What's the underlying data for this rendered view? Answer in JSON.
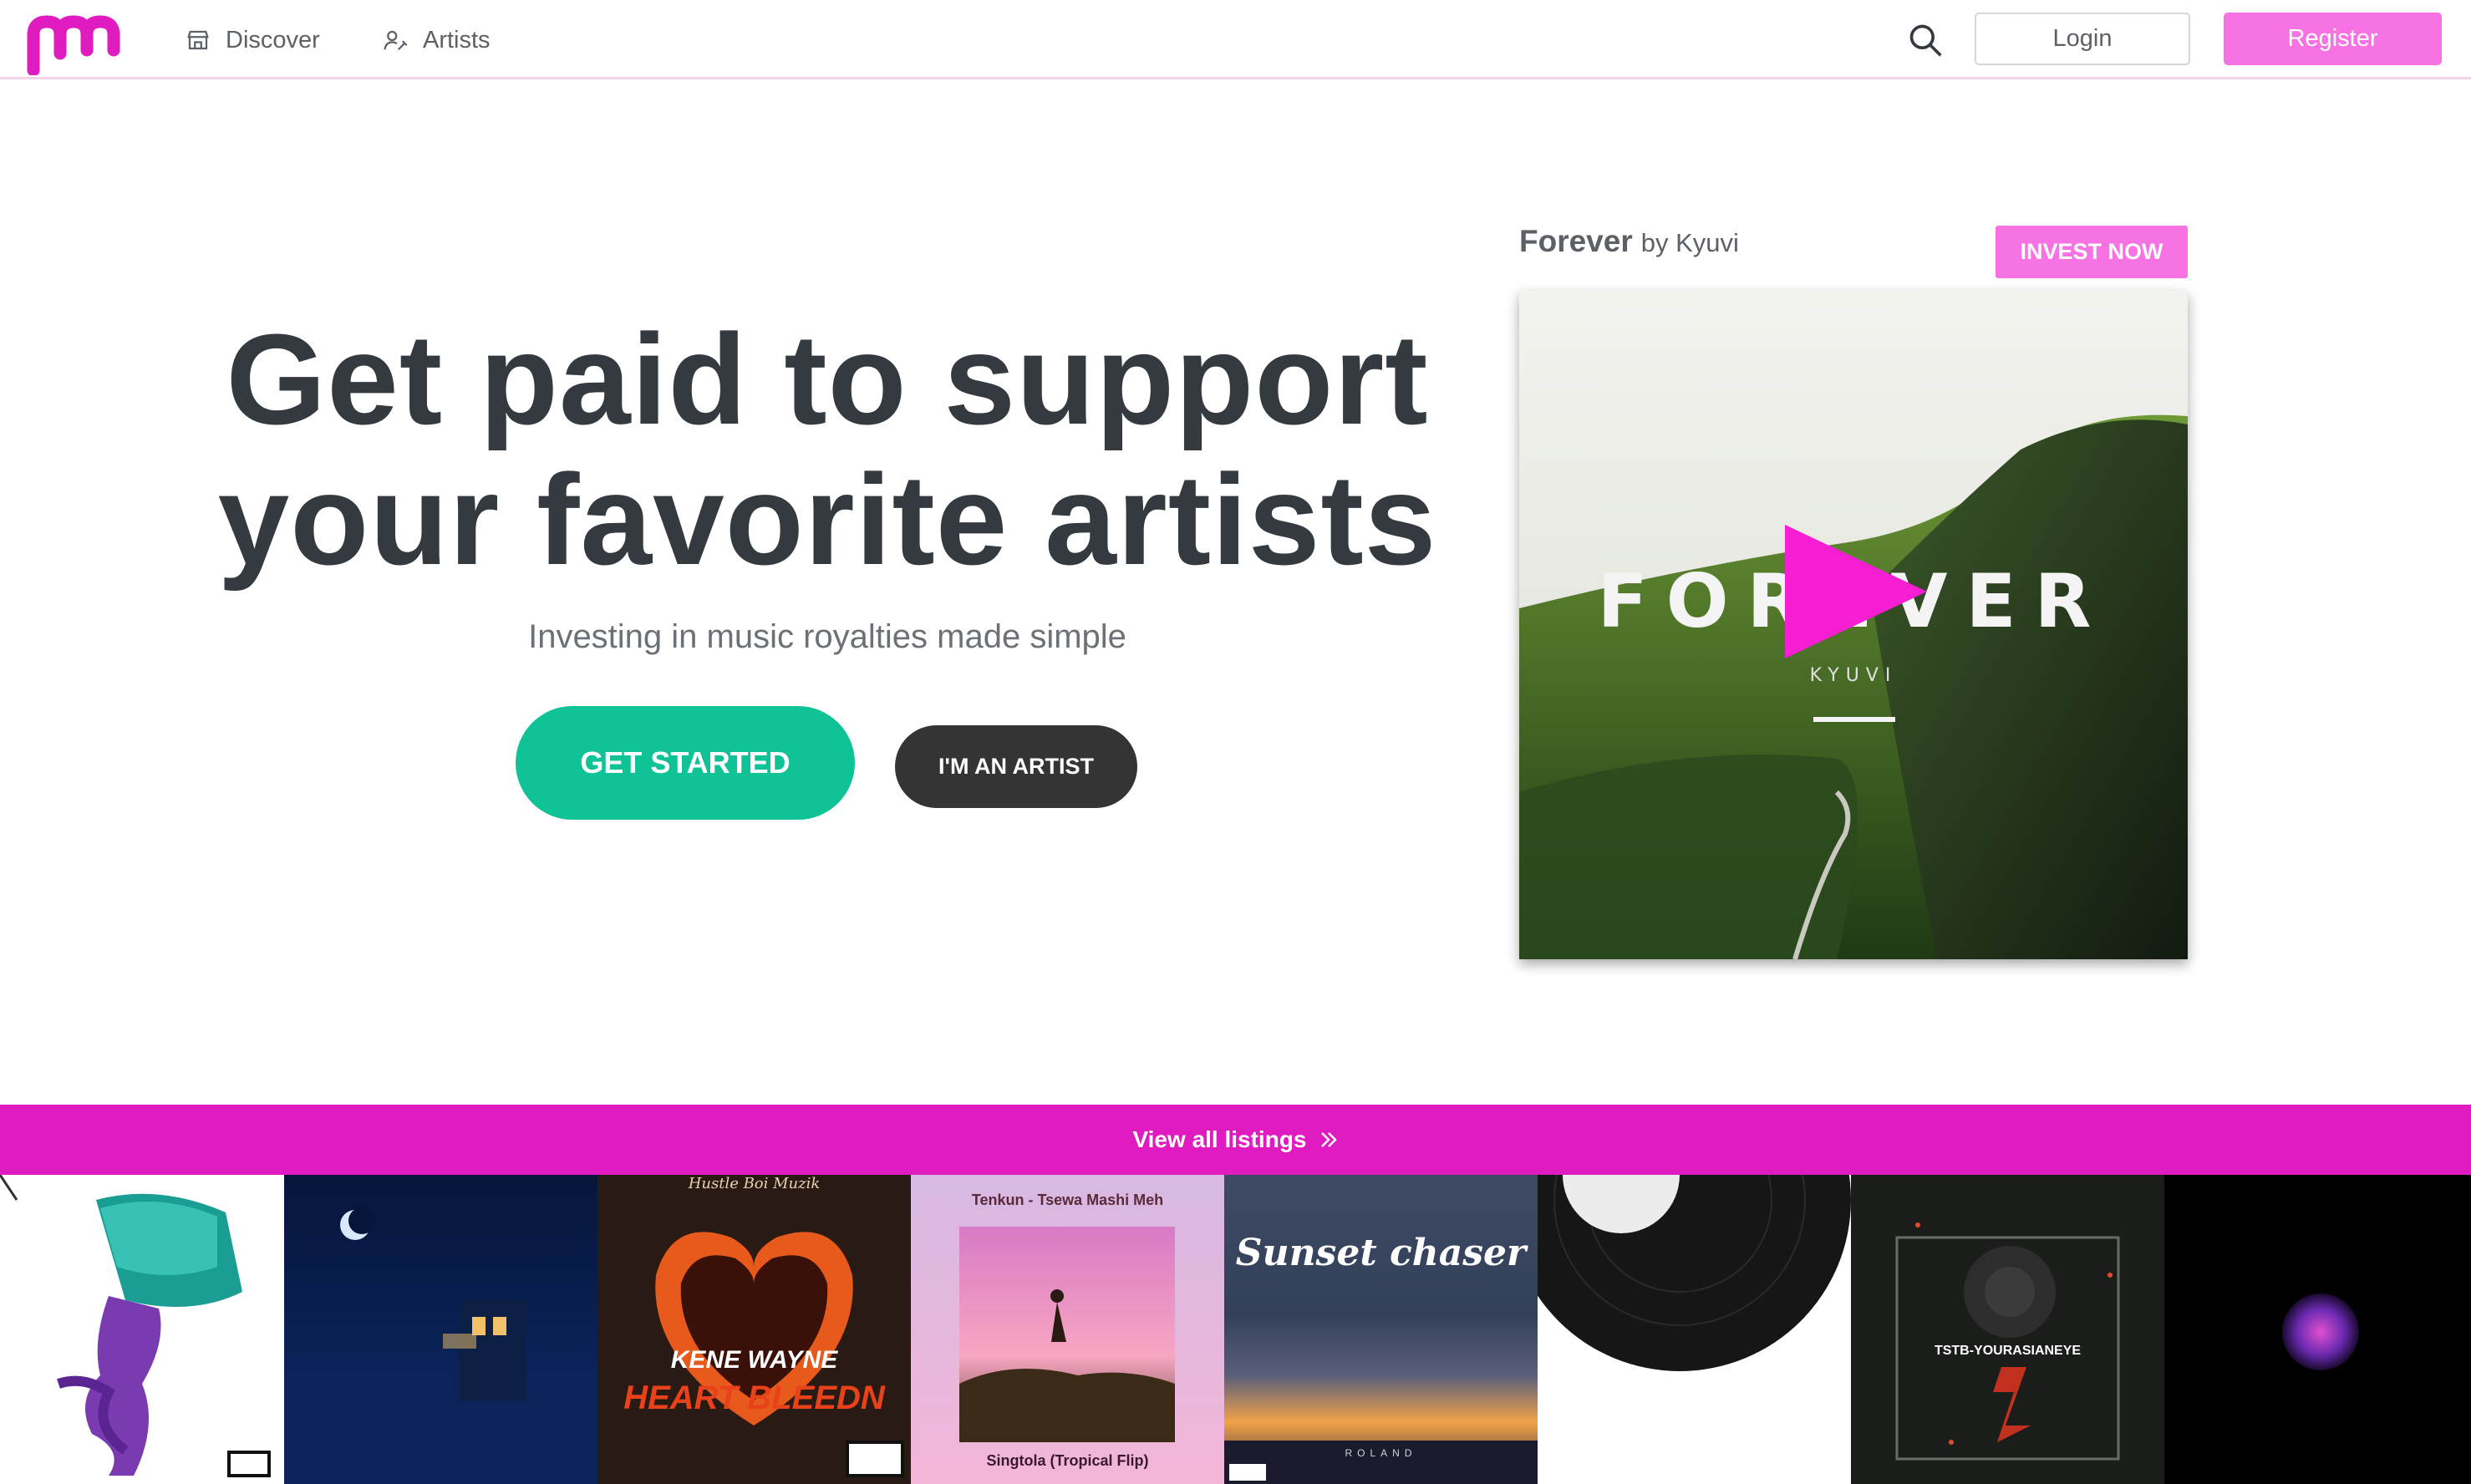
{
  "nav": {
    "logo_icon": "brand-logo",
    "discover_label": "Discover",
    "discover_icon": "store-icon",
    "artists_label": "Artists",
    "artists_icon": "artists-icon",
    "search_icon": "search-icon",
    "login_label": "Login",
    "register_label": "Register"
  },
  "hero": {
    "title_line1": "Get paid to support",
    "title_line2": "your favorite artists",
    "subtitle": "Investing in music royalties made simple",
    "get_started_label": "GET STARTED",
    "artist_label": "I'M AN ARTIST"
  },
  "featured": {
    "song": "Forever",
    "by": "by Kyuvi",
    "invest_label": "INVEST NOW",
    "cover_title": "FOREVER",
    "cover_artist": "KYUVI"
  },
  "listings": {
    "label": "View all listings",
    "icon": "double-chevron-right-icon"
  },
  "covers": [
    {
      "id": "cover-wavy",
      "text": ""
    },
    {
      "id": "cover-night",
      "text": ""
    },
    {
      "id": "cover-heart-bleedn",
      "top": "Hustle Boi Muzik",
      "line1": "KENE WAYNE",
      "line2": "HEART BLEEDN"
    },
    {
      "id": "cover-tsewa",
      "top": "Tenkun - Tsewa Mashi Meh",
      "bottom": "Singtola (Tropical Flip)"
    },
    {
      "id": "cover-sunset",
      "title": "Sunset chaser",
      "bottom": "ROLAND"
    },
    {
      "id": "cover-vinyl",
      "text": ""
    },
    {
      "id": "cover-tstb",
      "title": "TSTB-YOURASIANEYE"
    },
    {
      "id": "cover-galaxy",
      "text": ""
    }
  ],
  "colors": {
    "brand_pink": "#f772e2",
    "magenta": "#e01bc0",
    "green": "#10c396",
    "dark": "#343434",
    "text": "#343a40"
  }
}
